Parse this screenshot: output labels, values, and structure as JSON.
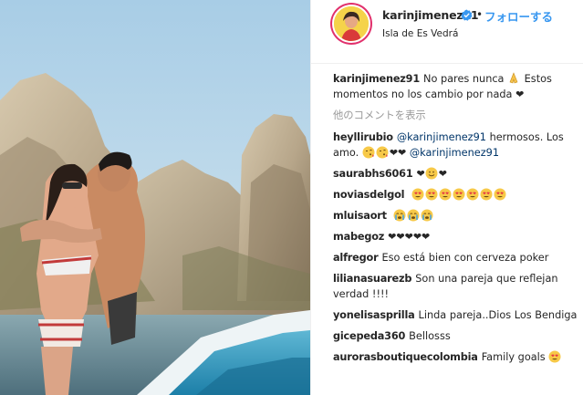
{
  "header": {
    "username": "karinjimenez91",
    "follow_label": "フォローする",
    "location": "Isla de Es Vedrá",
    "separator": "•"
  },
  "caption": {
    "username": "karinjimenez91",
    "text_1": "No pares nunca",
    "text_2": "Estos momentos no los cambio por nada",
    "heart": "❤"
  },
  "load_more_label": "他のコメントを表示",
  "comments": [
    {
      "username": "heyllirubio",
      "mention_1": "@karinjimenez91",
      "text_1": " hermosos. Los amo. ",
      "hearts": "❤❤",
      "mention_2": "@karinjimenez91"
    },
    {
      "username": "saurabhs6061",
      "hearts_before": "❤",
      "hearts_after": "❤"
    },
    {
      "username": "noviasdelgol"
    },
    {
      "username": "mluisaort"
    },
    {
      "username": "mabegoz",
      "text": "❤❤❤❤❤"
    },
    {
      "username": "alfregor",
      "text": "Eso está bien con cerveza poker"
    },
    {
      "username": "lilianasuarezb",
      "text": "Son una pareja que reflejan verdad !!!!"
    },
    {
      "username": "yonelisasprilla",
      "text": "Linda pareja..Dios Los Bendiga"
    },
    {
      "username": "gicepeda360",
      "text": "Bellosss"
    },
    {
      "username": "aurorasboutiquecolombia",
      "text": "Family goals"
    }
  ],
  "icons": {
    "verified": "verified-badge-icon",
    "pray": "folded-hands-emoji",
    "winking_kiss": "face-blowing-kiss-emoji",
    "smiley": "smiling-face-emoji",
    "heart_eyes": "heart-eyes-emoji",
    "crying": "crying-face-emoji"
  },
  "colors": {
    "link": "#3897f0",
    "mention": "#003569",
    "muted": "#999999",
    "text": "#262626"
  }
}
